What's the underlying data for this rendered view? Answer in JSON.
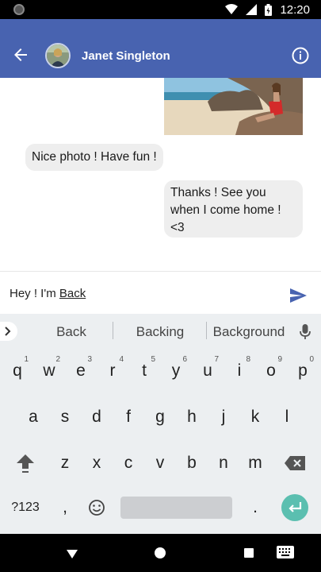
{
  "status_bar": {
    "time": "12:20"
  },
  "header": {
    "contact_name": "Janet Singleton"
  },
  "messages": [
    {
      "direction": "out",
      "type": "photo"
    },
    {
      "direction": "in",
      "text": "Nice photo ! Have fun !"
    },
    {
      "direction": "out",
      "text": "Thanks ! See you when I come home ! <3"
    }
  ],
  "composer": {
    "typed_prefix": "Hey ! I'm ",
    "typed_word": "Back"
  },
  "keyboard": {
    "suggestions": [
      "Back",
      "Backing",
      "Background"
    ],
    "row1": [
      {
        "key": "q",
        "hint": "1"
      },
      {
        "key": "w",
        "hint": "2"
      },
      {
        "key": "e",
        "hint": "3"
      },
      {
        "key": "r",
        "hint": "4"
      },
      {
        "key": "t",
        "hint": "5"
      },
      {
        "key": "y",
        "hint": "6"
      },
      {
        "key": "u",
        "hint": "7"
      },
      {
        "key": "i",
        "hint": "8"
      },
      {
        "key": "o",
        "hint": "9"
      },
      {
        "key": "p",
        "hint": "0"
      }
    ],
    "row2": [
      "a",
      "s",
      "d",
      "f",
      "g",
      "h",
      "j",
      "k",
      "l"
    ],
    "row3": [
      "z",
      "x",
      "c",
      "v",
      "b",
      "n",
      "m"
    ],
    "symbols_label": "?123",
    "comma": ",",
    "period": "."
  },
  "colors": {
    "app_bar": "#4863b0",
    "accent_send": "#4863b0",
    "enter": "#5bbfb0",
    "bubble": "#eeeeee"
  }
}
